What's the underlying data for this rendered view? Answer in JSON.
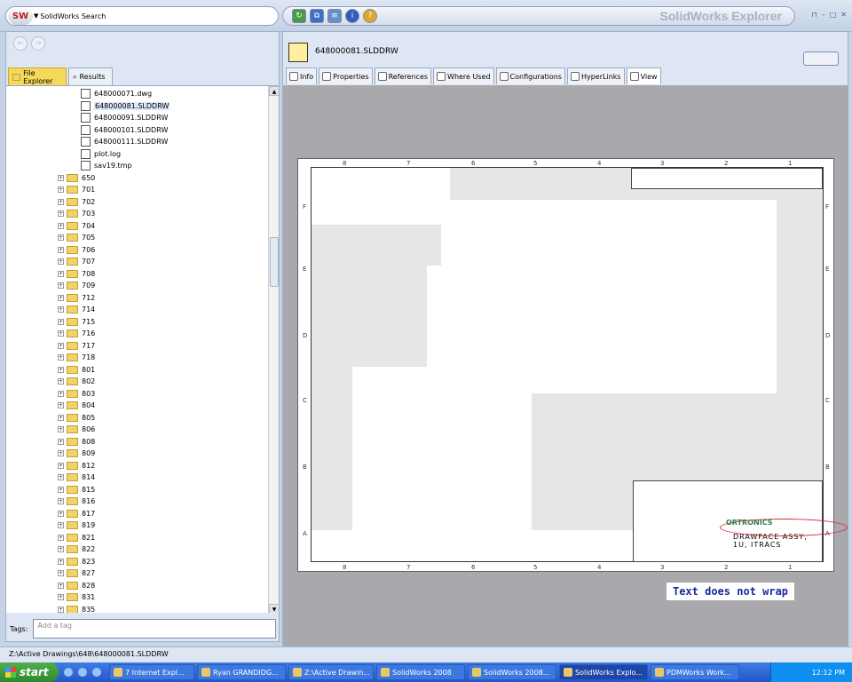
{
  "app": {
    "title": "SolidWorks Explorer",
    "search_placeholder": "SolidWorks Search",
    "window_controls": [
      "restore",
      "minimize",
      "maximize",
      "close"
    ]
  },
  "left": {
    "tabs": [
      "File Explorer",
      "Results"
    ],
    "files": [
      {
        "name": "648000071.dwg",
        "type": "dwg"
      },
      {
        "name": "648000081.SLDDRW",
        "type": "slddrw",
        "selected": true
      },
      {
        "name": "648000091.SLDDRW",
        "type": "slddrw"
      },
      {
        "name": "648000101.SLDDRW",
        "type": "slddrw"
      },
      {
        "name": "648000111.SLDDRW",
        "type": "slddrw"
      },
      {
        "name": "plot.log",
        "type": "log"
      },
      {
        "name": "sav19.tmp",
        "type": "tmp"
      }
    ],
    "folders": [
      "650",
      "701",
      "702",
      "703",
      "704",
      "705",
      "706",
      "707",
      "708",
      "709",
      "712",
      "714",
      "715",
      "716",
      "717",
      "718",
      "801",
      "802",
      "803",
      "804",
      "805",
      "806",
      "808",
      "809",
      "812",
      "814",
      "815",
      "816",
      "817",
      "819",
      "821",
      "822",
      "823",
      "827",
      "828",
      "831",
      "835"
    ],
    "tags_label": "Tags:",
    "tags_placeholder": "Add a tag"
  },
  "right": {
    "doc_name": "648000081.SLDDRW",
    "tabs": [
      "Info",
      "Properties",
      "References",
      "Where Used",
      "Configurations",
      "HyperLinks",
      "View"
    ],
    "active_tab": "View"
  },
  "drawing": {
    "zones_top": [
      "8",
      "7",
      "6",
      "5",
      "4",
      "3",
      "2",
      "1"
    ],
    "zones_side": [
      "F",
      "E",
      "D",
      "C",
      "B",
      "A"
    ],
    "title_text": "DRAWFACE ASSY, 1U, ITRACS",
    "company": "ORTRONICS",
    "annotation": "Text does not wrap"
  },
  "status_path": "Z:\\Active Drawings\\648\\648000081.SLDDRW",
  "taskbar": {
    "start": "start",
    "tasks": [
      "7 Internet Expl...",
      "Ryan GRANDIDG...",
      "Z:\\Active Drawin...",
      "SolidWorks 2008",
      "SolidWorks 2008...",
      "SolidWorks Explo...",
      "PDMWorks Work..."
    ],
    "active_task": "SolidWorks Explo...",
    "clock": "12:12 PM"
  }
}
